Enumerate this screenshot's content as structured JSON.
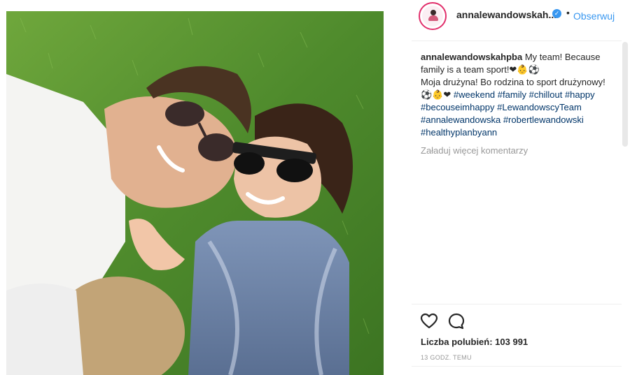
{
  "photo": {
    "alt_icon": "family-selfie-photo"
  },
  "header": {
    "username": "annalewandowskah...",
    "verified_icon": "verified-badge-icon",
    "separator": "•",
    "follow_label": "Obserwuj"
  },
  "caption": {
    "username": "annalewandowskahpba",
    "line1": " My team! Because family is a team sport!❤👶⚽",
    "line2": "Moja drużyna! Bo rodzina to sport drużynowy! ⚽👶❤ ",
    "tags": [
      "#weekend",
      "#family",
      "#chillout",
      "#happy",
      "#becouseimhappy",
      "#LewandowscyTeam",
      "#annalewandowska",
      "#robertlewandowski",
      "#healthyplanbyann"
    ]
  },
  "load_more": "Załaduj więcej komentarzy",
  "likes": "Liczba polubień: 103 991",
  "time": "13 GODZ. TEMU",
  "colors": {
    "link": "#3897f0",
    "hashtag": "#003569",
    "muted": "#999999",
    "text": "#262626"
  }
}
